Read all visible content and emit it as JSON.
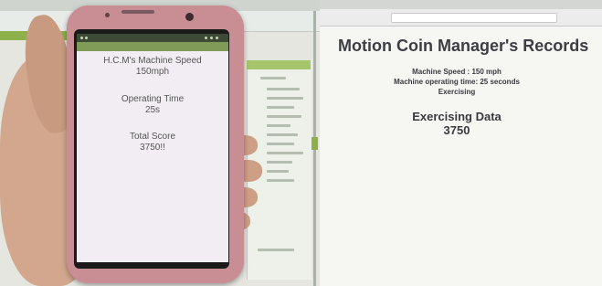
{
  "phone_app": {
    "speed_label": "H.C.M's Machine Speed",
    "speed_value": "150mph",
    "time_label": "Operating Time",
    "time_value": "25s",
    "score_label": "Total Score",
    "score_value": "3750!!"
  },
  "web_page": {
    "title": "Motion Coin Manager's Records",
    "speed_line": "Machine Speed : 150 mph",
    "time_line": "Machine operating time: 25 seconds",
    "status_line": "Exercising",
    "section_title": "Exercising Data",
    "section_value": "3750"
  },
  "colors": {
    "phone_body": "#c98d94",
    "app_bar": "#7f9b57",
    "web_background": "#f6f6f2",
    "web_text": "#3a3a40"
  }
}
